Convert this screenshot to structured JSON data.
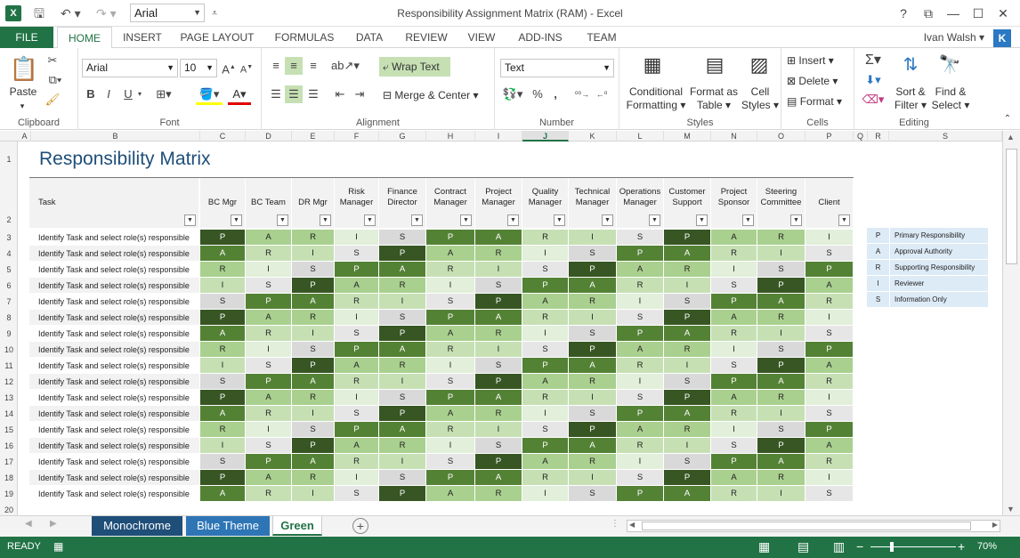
{
  "window": {
    "title": "Responsibility Assignment Matrix (RAM) - Excel",
    "help": "?",
    "restore": "⧉",
    "minimize": "—",
    "maximize": "☐",
    "close": "✕"
  },
  "quick_access": {
    "save_icon": "save-icon",
    "undo_icon": "undo-icon",
    "redo_icon": "redo-icon",
    "font_name": "Arial"
  },
  "ribbon_tabs": [
    "FILE",
    "HOME",
    "INSERT",
    "PAGE LAYOUT",
    "FORMULAS",
    "DATA",
    "REVIEW",
    "VIEW",
    "ADD-INS",
    "TEAM"
  ],
  "user": {
    "name": "Ivan Walsh",
    "initial": "K"
  },
  "ribbon": {
    "clipboard": {
      "paste": "Paste",
      "group": "Clipboard"
    },
    "font": {
      "name": "Arial",
      "size": "10",
      "group": "Font",
      "bold": "B",
      "italic": "I",
      "underline": "U"
    },
    "alignment": {
      "wrap_text": "Wrap Text",
      "merge_center": "Merge & Center",
      "group": "Alignment"
    },
    "number": {
      "format": "Text",
      "group": "Number",
      "percent": "%",
      "comma": ","
    },
    "styles": {
      "conditional_1": "Conditional",
      "conditional_2": "Formatting",
      "format_table_1": "Format as",
      "format_table_2": "Table",
      "cell_styles_1": "Cell",
      "cell_styles_2": "Styles",
      "group": "Styles"
    },
    "cells": {
      "insert": "Insert",
      "delete": "Delete",
      "format": "Format",
      "group": "Cells"
    },
    "editing": {
      "sort_1": "Sort &",
      "sort_2": "Filter",
      "find_1": "Find &",
      "find_2": "Select",
      "group": "Editing"
    }
  },
  "columns": [
    "A",
    "B",
    "C",
    "D",
    "E",
    "F",
    "G",
    "H",
    "I",
    "J",
    "K",
    "L",
    "M",
    "N",
    "O",
    "P",
    "Q",
    "R",
    "S"
  ],
  "selected_column": "J",
  "rows": [
    "1",
    "2",
    "3",
    "4",
    "5",
    "6",
    "7",
    "8",
    "9",
    "10",
    "11",
    "12",
    "13",
    "14",
    "15",
    "16",
    "17",
    "18",
    "19",
    "20"
  ],
  "sheet": {
    "title": "Responsibility Matrix",
    "task_header": "Task",
    "roles": [
      {
        "l1": "",
        "l2": "BC Mgr"
      },
      {
        "l1": "",
        "l2": "BC Team"
      },
      {
        "l1": "",
        "l2": "DR Mgr"
      },
      {
        "l1": "Risk",
        "l2": "Manager"
      },
      {
        "l1": "Finance",
        "l2": "Director"
      },
      {
        "l1": "Contract",
        "l2": "Manager"
      },
      {
        "l1": "Project",
        "l2": "Manager"
      },
      {
        "l1": "Quality",
        "l2": "Manager"
      },
      {
        "l1": "Technical",
        "l2": "Manager"
      },
      {
        "l1": "Operations",
        "l2": "Manager"
      },
      {
        "l1": "Customer",
        "l2": "Support"
      },
      {
        "l1": "Project",
        "l2": "Sponsor"
      },
      {
        "l1": "Steering",
        "l2": "Committee"
      },
      {
        "l1": "",
        "l2": "Client"
      }
    ],
    "task_label": "Identify Task and select role(s) responsible",
    "pattern": [
      [
        "P",
        "A",
        "R",
        "I",
        "S",
        "P",
        "A",
        "R",
        "I",
        "S",
        "P",
        "A",
        "R",
        "I"
      ],
      [
        "A",
        "R",
        "I",
        "S",
        "P",
        "A",
        "R",
        "I",
        "S",
        "P",
        "A",
        "R",
        "I",
        "S"
      ],
      [
        "R",
        "I",
        "S",
        "P",
        "A",
        "R",
        "I",
        "S",
        "P",
        "A",
        "R",
        "I",
        "S",
        "P"
      ],
      [
        "I",
        "S",
        "P",
        "A",
        "R",
        "I",
        "S",
        "P",
        "A",
        "R",
        "I",
        "S",
        "P",
        "A"
      ],
      [
        "S",
        "P",
        "A",
        "R",
        "I",
        "S",
        "P",
        "A",
        "R",
        "I",
        "S",
        "P",
        "A",
        "R"
      ]
    ],
    "row_count": 17,
    "colors": {
      "P": "#e2efda",
      "A": "#548235",
      "R": "#a9d08e",
      "I": "#c6e0b4",
      "S": "#d9d9d9"
    },
    "colors_by_col": [
      {
        "P": "#548235",
        "A": "#a9d08e",
        "R": "#c6e0b4",
        "I": "#e2efda",
        "S": "#d9d9d9"
      },
      {
        "P": "#375623",
        "A": "#548235",
        "R": "#a9d08e",
        "I": "#c6e0b4",
        "S": "#d9d9d9"
      }
    ]
  },
  "legend": [
    {
      "code": "P",
      "desc": "Primary Responsibility"
    },
    {
      "code": "A",
      "desc": "Approval Authority"
    },
    {
      "code": "R",
      "desc": "Supporting Responsibility"
    },
    {
      "code": "I",
      "desc": "Reviewer"
    },
    {
      "code": "S",
      "desc": "Information Only"
    }
  ],
  "sheet_tabs": [
    {
      "label": "Monochrome",
      "bg": "#1f4e79",
      "active": false
    },
    {
      "label": "Blue Theme",
      "bg": "#2e75b6",
      "active": false
    },
    {
      "label": "Green",
      "bg": "#ffffff",
      "active": true
    }
  ],
  "status": {
    "ready": "READY",
    "zoom": "70%"
  }
}
